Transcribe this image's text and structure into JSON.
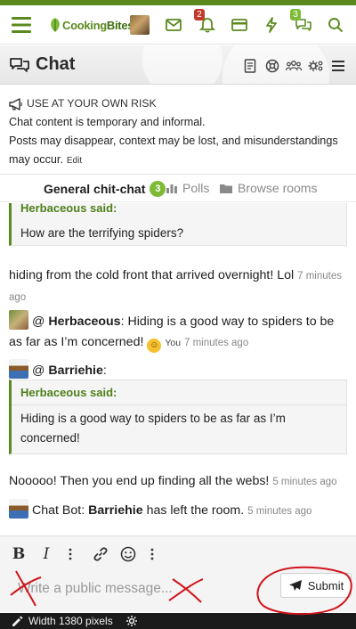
{
  "header": {
    "logo_text_1": "Cooking",
    "logo_text_2": "Bites",
    "icons": [
      "menu-icon",
      "mail-icon",
      "bell-icon",
      "card-icon",
      "bolt-icon",
      "chat-icon",
      "search-icon"
    ],
    "alerts_badge": "2",
    "conversations_badge": "3",
    "colors": {
      "accent": "#5c8a1f",
      "alert_badge": "#c0392b",
      "convo_badge": "#7dbb37"
    }
  },
  "page": {
    "title": "Chat",
    "title_icons": [
      "rules-icon",
      "help-icon",
      "members-icon",
      "settings-icon",
      "list-icon"
    ]
  },
  "notice": {
    "heading": "USE AT YOUR OWN RISK",
    "line1": "Chat content is temporary and informal.",
    "line2": "Posts may disappear, context may be lost, and misunderstandings may occur.",
    "edit": "Edit"
  },
  "tabs": {
    "active": "General chit-chat",
    "active_count": "3",
    "polls": "Polls",
    "browse": "Browse rooms"
  },
  "messages": {
    "quote1_author": "Herbaceous said:",
    "quote1_body": "How are the terrifying spiders?",
    "m1_text": "hiding from the cold front that arrived overnight! Lol",
    "m1_time": "7 minutes ago",
    "m2_at": "@",
    "m2_name": "Herbaceous",
    "m2_text": ": Hiding is a good way to spiders to be as far as I’m concerned!",
    "m2_you": "You",
    "m2_time": "7 minutes ago",
    "m3_at": "@",
    "m3_name": "Barriehie",
    "m3_colon": ":",
    "quote2_author": "Herbaceous said:",
    "quote2_body": "Hiding is a good way to spiders to be as far as I’m concerned!",
    "m4_text": "Nooooo! Then you end up finding all the webs!",
    "m4_time": "5 minutes ago",
    "m5_prefix": "Chat Bot:",
    "m5_name": "Barriehie",
    "m5_text": "has left the room.",
    "m5_time": "5 minutes ago"
  },
  "editor": {
    "bold": "B",
    "italic": "I",
    "placeholder": "Write a public message...",
    "submit": "Submit"
  },
  "footer": {
    "width_text": "Width 1380 pixels"
  }
}
